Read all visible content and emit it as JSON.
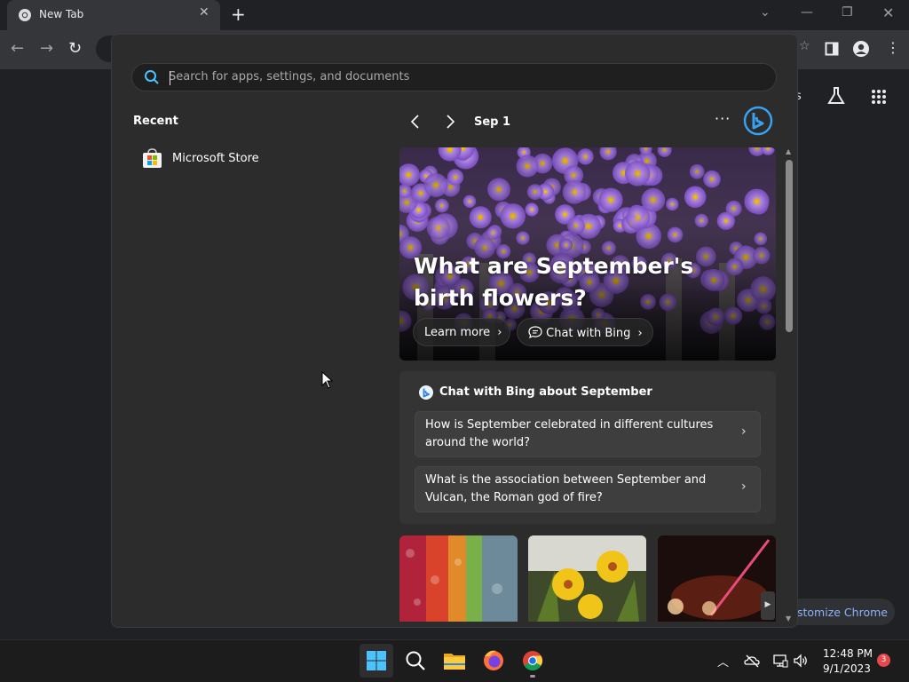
{
  "browser": {
    "tab_title": "New Tab",
    "ntp_right_label": "s",
    "customize_label": "stomize Chrome"
  },
  "start_menu": {
    "search": {
      "placeholder": "Search for apps, settings, and documents",
      "value": ""
    },
    "recent": {
      "title": "Recent",
      "items": [
        {
          "label": "Microsoft Store",
          "icon": "microsoft-store-icon"
        }
      ]
    },
    "feed": {
      "date": "Sep 1",
      "more_label": "···",
      "hero": {
        "title": "What are September's birth flowers?",
        "learn_more": "Learn more",
        "chat_with_bing": "Chat with Bing"
      },
      "chat_card": {
        "title": "Chat with Bing about September",
        "questions": [
          "How is September celebrated in different cultures around the world?",
          "What is the association between September and Vulcan, the Roman god of fire?"
        ]
      }
    }
  },
  "taskbar": {
    "time": "12:48 PM",
    "date": "9/1/2023",
    "notification_count": "3",
    "apps": [
      "start-icon",
      "search-icon",
      "file-explorer-icon",
      "firefox-icon",
      "chrome-icon"
    ]
  },
  "colors": {
    "accent": "#0078d4",
    "bing_blue": "#3aa0f0",
    "start_bg": "#2c2c2c",
    "taskbar_bg": "#1c1c1c"
  }
}
